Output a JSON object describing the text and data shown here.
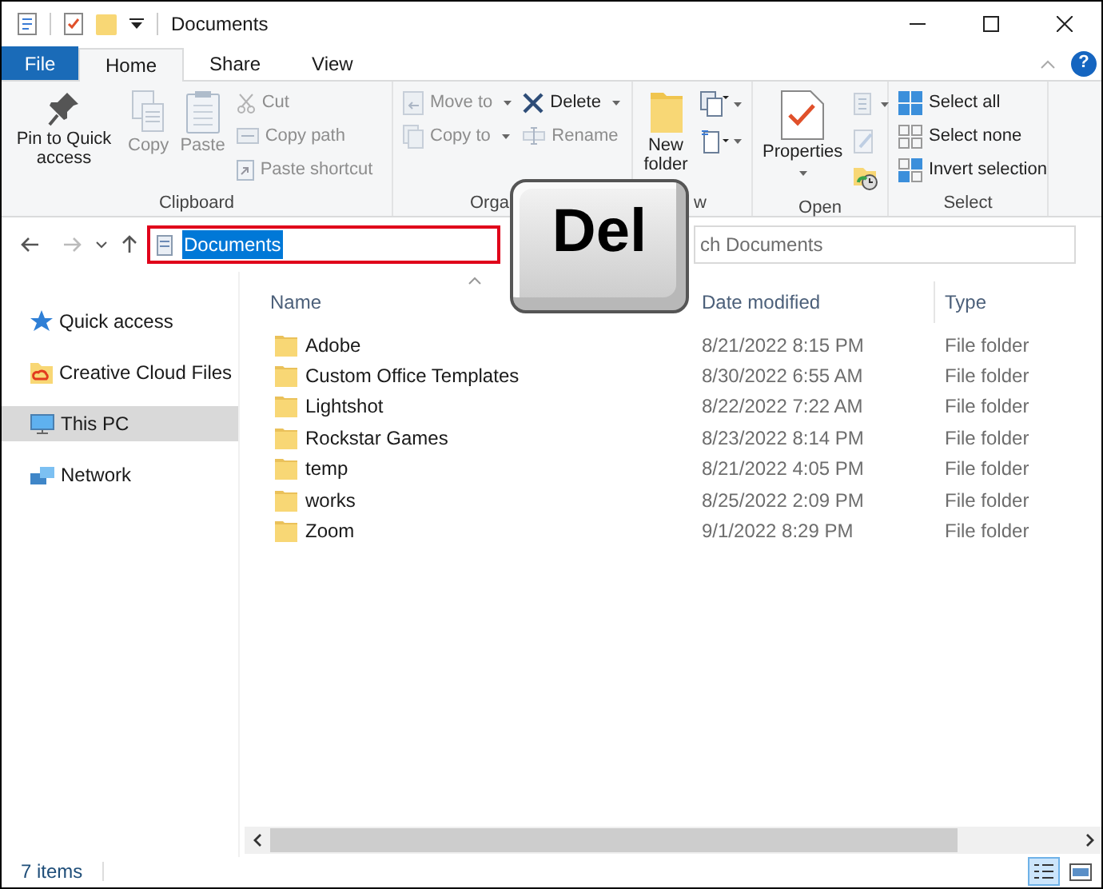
{
  "window": {
    "title": "Documents"
  },
  "ribbon_tabs": [
    {
      "label": "File",
      "kind": "file",
      "selected": false
    },
    {
      "label": "Home",
      "kind": "tab",
      "selected": true
    },
    {
      "label": "Share",
      "kind": "tab",
      "selected": false
    },
    {
      "label": "View",
      "kind": "tab",
      "selected": false
    }
  ],
  "ribbon": [
    {
      "label": "Clipboard",
      "columns": [
        [
          {
            "kind": "large",
            "label": "Pin to Quick access",
            "disabled": false
          }
        ],
        [
          {
            "kind": "large",
            "label": "Copy",
            "disabled": true
          }
        ],
        [
          {
            "kind": "large",
            "label": "Paste",
            "disabled": true
          }
        ],
        [
          {
            "kind": "small",
            "label": "Cut",
            "disabled": true
          },
          {
            "kind": "small",
            "label": "Copy path",
            "disabled": true
          },
          {
            "kind": "small",
            "label": "Paste shortcut",
            "disabled": true
          }
        ]
      ]
    },
    {
      "label": "Orga",
      "columns": [
        [
          {
            "kind": "small",
            "label": "Move to",
            "disabled": true,
            "dropdown": true
          },
          {
            "kind": "small",
            "label": "Copy to",
            "disabled": true,
            "dropdown": true
          }
        ],
        [
          {
            "kind": "small",
            "label": "Delete",
            "disabled": false,
            "dropdown": true
          },
          {
            "kind": "small",
            "label": "Rename",
            "disabled": true
          }
        ]
      ]
    },
    {
      "label": "w",
      "columns": [
        [
          {
            "kind": "large",
            "label": "New folder",
            "disabled": false
          }
        ],
        [
          {
            "kind": "icon",
            "disabled": false,
            "dropdown": true
          },
          {
            "kind": "icon",
            "disabled": false,
            "dropdown": true
          }
        ]
      ]
    },
    {
      "label": "Open",
      "columns": [
        [
          {
            "kind": "large",
            "label": "Properties",
            "disabled": false,
            "dropdown": true
          }
        ],
        [
          {
            "kind": "icon",
            "disabled": true,
            "dropdown": true
          },
          {
            "kind": "icon",
            "disabled": true
          },
          {
            "kind": "icon",
            "disabled": false
          }
        ]
      ]
    },
    {
      "label": "Select",
      "columns": [
        [
          {
            "kind": "small",
            "label": "Select all",
            "disabled": false
          },
          {
            "kind": "small",
            "label": "Select none",
            "disabled": false
          },
          {
            "kind": "small",
            "label": "Invert selection",
            "disabled": false
          }
        ]
      ]
    }
  ],
  "address": {
    "value": "Documents",
    "highlighted": true
  },
  "search": {
    "placeholder": "ch Documents"
  },
  "overlay_key": {
    "label": "Del"
  },
  "help": {
    "label": "?"
  },
  "nav_pane": [
    {
      "label": "Quick access",
      "selected": false
    },
    {
      "label": "Creative Cloud Files",
      "selected": false
    },
    {
      "label": "This PC",
      "selected": true
    },
    {
      "label": "Network",
      "selected": false
    }
  ],
  "columns": [
    "Name",
    "Date modified",
    "Type"
  ],
  "rows": [
    {
      "name": "Adobe",
      "date": "8/21/2022 8:15 PM",
      "type": "File folder"
    },
    {
      "name": "Custom Office Templates",
      "date": "8/30/2022 6:55 AM",
      "type": "File folder"
    },
    {
      "name": "Lightshot",
      "date": "8/22/2022 7:22 AM",
      "type": "File folder"
    },
    {
      "name": "Rockstar Games",
      "date": "8/23/2022 8:14 PM",
      "type": "File folder"
    },
    {
      "name": "temp",
      "date": "8/21/2022 4:05 PM",
      "type": "File folder"
    },
    {
      "name": "works",
      "date": "8/25/2022 2:09 PM",
      "type": "File folder"
    },
    {
      "name": "Zoom",
      "date": "9/1/2022 8:29 PM",
      "type": "File folder"
    }
  ],
  "status_bar": {
    "count": "7 items"
  }
}
